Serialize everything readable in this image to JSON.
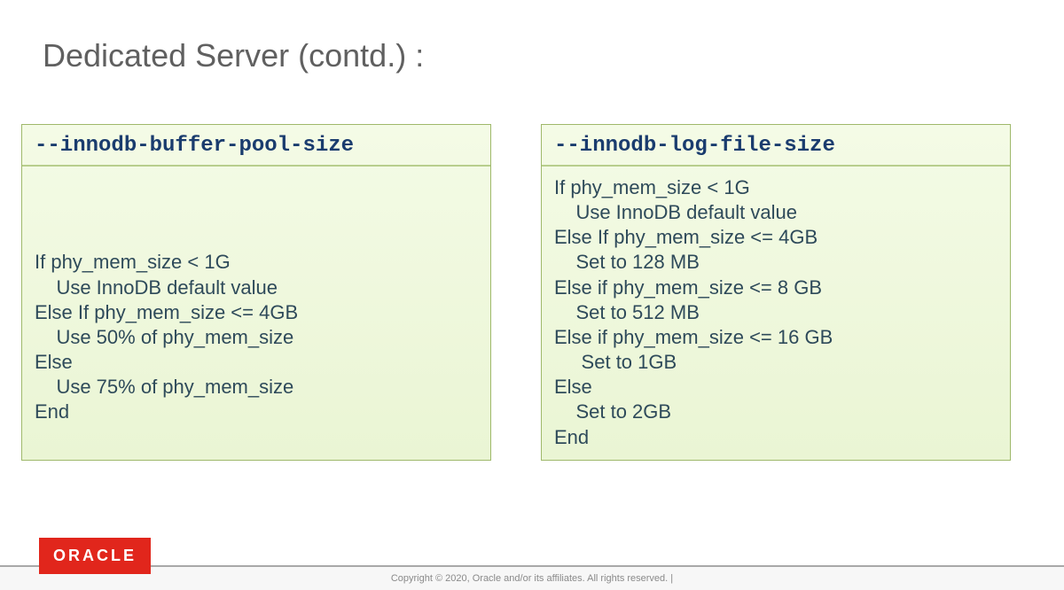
{
  "title": "Dedicated Server (contd.) :",
  "left": {
    "option": "--innodb-buffer-pool-size",
    "body": "\n\n\nIf phy_mem_size < 1G\n    Use InnoDB default value\nElse If phy_mem_size <= 4GB\n    Use 50% of phy_mem_size\nElse\n    Use 75% of phy_mem_size\nEnd"
  },
  "right": {
    "option": "--innodb-log-file-size",
    "body": "If phy_mem_size < 1G\n    Use InnoDB default value\nElse If phy_mem_size <= 4GB\n    Set to 128 MB\nElse if phy_mem_size <= 8 GB\n    Set to 512 MB\nElse if phy_mem_size <= 16 GB\n     Set to 1GB\nElse\n    Set to 2GB\nEnd"
  },
  "brand": "ORACLE",
  "copyright": "Copyright © 2020, Oracle and/or its affiliates. All rights reserved.  |"
}
